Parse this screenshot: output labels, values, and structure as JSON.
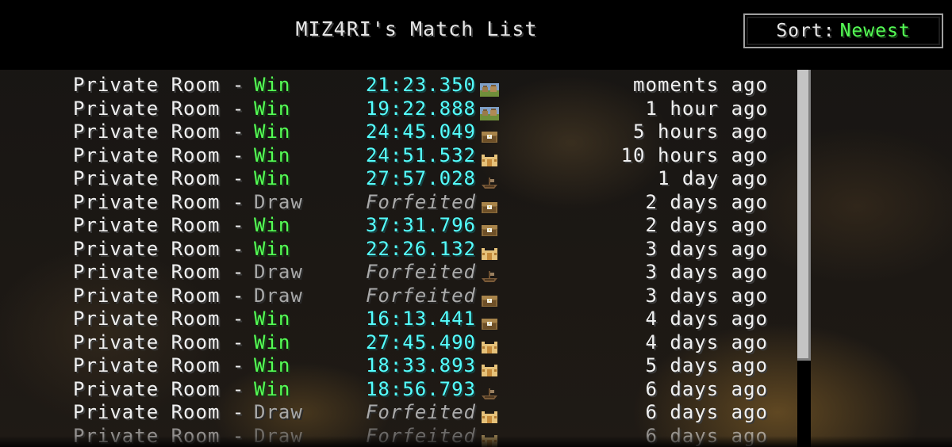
{
  "header": {
    "title": "MIZ4RI's Match List",
    "sort_label": "Sort:",
    "sort_value": "Newest"
  },
  "colors": {
    "win": "#55ff55",
    "draw": "#a8a8a8",
    "time": "#55ffff",
    "forfeit": "#aaaaaa",
    "text": "#f0f0f0"
  },
  "matches": [
    {
      "room": "Private Room - ",
      "result": "Win",
      "time": "21:23.350",
      "forfeit": false,
      "icon": "village-icon",
      "ago": "moments ago"
    },
    {
      "room": "Private Room - ",
      "result": "Win",
      "time": "19:22.888",
      "forfeit": false,
      "icon": "village-icon",
      "ago": "1 hour ago"
    },
    {
      "room": "Private Room - ",
      "result": "Win",
      "time": "24:45.049",
      "forfeit": false,
      "icon": "chest-icon",
      "ago": "5 hours ago"
    },
    {
      "room": "Private Room - ",
      "result": "Win",
      "time": "24:51.532",
      "forfeit": false,
      "icon": "temple-icon",
      "ago": "10 hours ago"
    },
    {
      "room": "Private Room - ",
      "result": "Win",
      "time": "27:57.028",
      "forfeit": false,
      "icon": "shipwreck-icon",
      "ago": "1 day ago"
    },
    {
      "room": "Private Room - ",
      "result": "Draw",
      "time": "Forfeited",
      "forfeit": true,
      "icon": "chest-icon",
      "ago": "2 days ago"
    },
    {
      "room": "Private Room - ",
      "result": "Win",
      "time": "37:31.796",
      "forfeit": false,
      "icon": "chest-icon",
      "ago": "2 days ago"
    },
    {
      "room": "Private Room - ",
      "result": "Win",
      "time": "22:26.132",
      "forfeit": false,
      "icon": "temple-icon",
      "ago": "3 days ago"
    },
    {
      "room": "Private Room - ",
      "result": "Draw",
      "time": "Forfeited",
      "forfeit": true,
      "icon": "shipwreck-icon",
      "ago": "3 days ago"
    },
    {
      "room": "Private Room - ",
      "result": "Draw",
      "time": "Forfeited",
      "forfeit": true,
      "icon": "chest-icon",
      "ago": "3 days ago"
    },
    {
      "room": "Private Room - ",
      "result": "Win",
      "time": "16:13.441",
      "forfeit": false,
      "icon": "chest-icon",
      "ago": "4 days ago"
    },
    {
      "room": "Private Room - ",
      "result": "Win",
      "time": "27:45.490",
      "forfeit": false,
      "icon": "temple-icon",
      "ago": "4 days ago"
    },
    {
      "room": "Private Room - ",
      "result": "Win",
      "time": "18:33.893",
      "forfeit": false,
      "icon": "temple-icon",
      "ago": "5 days ago"
    },
    {
      "room": "Private Room - ",
      "result": "Win",
      "time": "18:56.793",
      "forfeit": false,
      "icon": "shipwreck-icon",
      "ago": "6 days ago"
    },
    {
      "room": "Private Room - ",
      "result": "Draw",
      "time": "Forfeited",
      "forfeit": true,
      "icon": "temple-icon",
      "ago": "6 days ago"
    },
    {
      "room": "Private Room - ",
      "result": "Draw",
      "time": "Forfeited",
      "forfeit": true,
      "icon": "temple-icon",
      "ago": "6 days ago"
    }
  ]
}
